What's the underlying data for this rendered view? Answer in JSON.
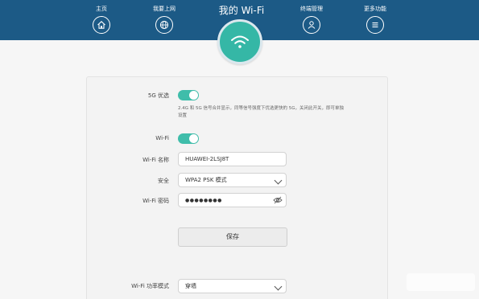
{
  "nav": {
    "home": "主页",
    "internet": "我要上网",
    "title": "我的 Wi-Fi",
    "devices": "终端管理",
    "more": "更多功能"
  },
  "icons": {
    "home": "home-icon",
    "internet": "globe-icon",
    "wifi": "wifi-icon",
    "devices": "user-icon",
    "more": "menu-icon",
    "password_toggle": "eye-icon"
  },
  "colors": {
    "header": "#1c5a86",
    "accent": "#35b7a6",
    "toggle_on": "#3fbdaa"
  },
  "form": {
    "five_g_label": "5G 优选",
    "five_g_on": true,
    "five_g_desc": "2.4G 和 5G 信号合并显示，同等信号强度下优选更快的 5G，关闭此开关，即可单独设置",
    "wifi_label": "Wi-Fi",
    "wifi_on": true,
    "ssid_label": "Wi-Fi 名称",
    "ssid_value": "HUAWEI-2LSJ8T",
    "security_label": "安全",
    "security_value": "WPA2 PSK 模式",
    "password_label": "Wi-Fi 密码",
    "password_value": "●●●●●●●●",
    "save_label": "保存",
    "power_mode_label": "Wi-Fi 功率模式",
    "power_mode_value": "穿墙"
  }
}
